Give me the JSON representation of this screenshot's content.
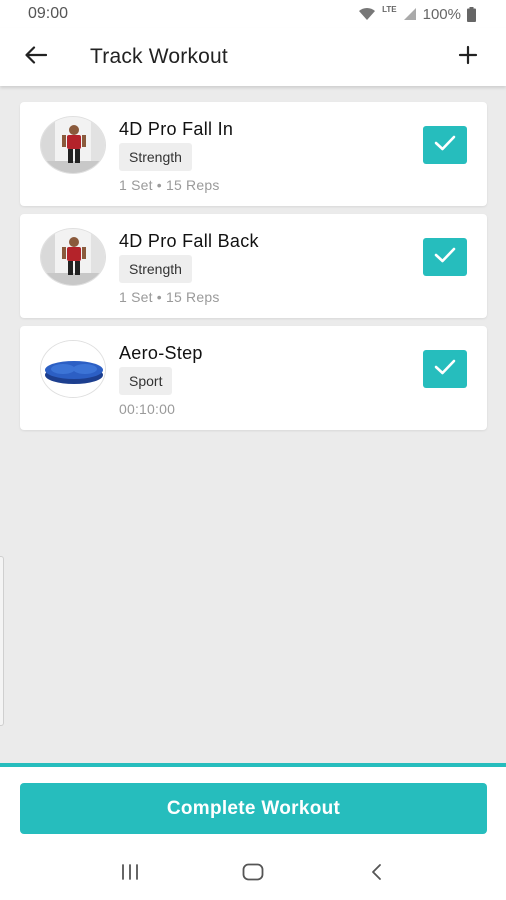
{
  "status_bar": {
    "time": "09:00",
    "network": "LTE",
    "battery": "100%",
    "icons": [
      "wifi-icon",
      "signal-icon",
      "battery-icon"
    ]
  },
  "app_bar": {
    "title": "Track Workout",
    "back_icon": "back-arrow-icon",
    "add_icon": "plus-icon"
  },
  "workouts": [
    {
      "name": "4D Pro Fall In",
      "category": "Strength",
      "detail": "1 Set • 15 Reps",
      "completed": true,
      "thumbnail": "person-exercise-photo"
    },
    {
      "name": "4D Pro Fall Back",
      "category": "Strength",
      "detail": "1 Set • 15 Reps",
      "completed": true,
      "thumbnail": "person-exercise-photo"
    },
    {
      "name": "Aero-Step",
      "category": "Sport",
      "detail": "00:10:00",
      "completed": true,
      "thumbnail": "aero-step-pad-photo"
    }
  ],
  "footer": {
    "complete_label": "Complete Workout"
  },
  "navigation": {
    "icons": [
      "recent-apps-icon",
      "home-icon",
      "back-icon"
    ]
  },
  "colors": {
    "accent": "#26bdbd",
    "background": "#ebebeb",
    "card": "#ffffff",
    "meta_text": "#9a9a9a"
  }
}
